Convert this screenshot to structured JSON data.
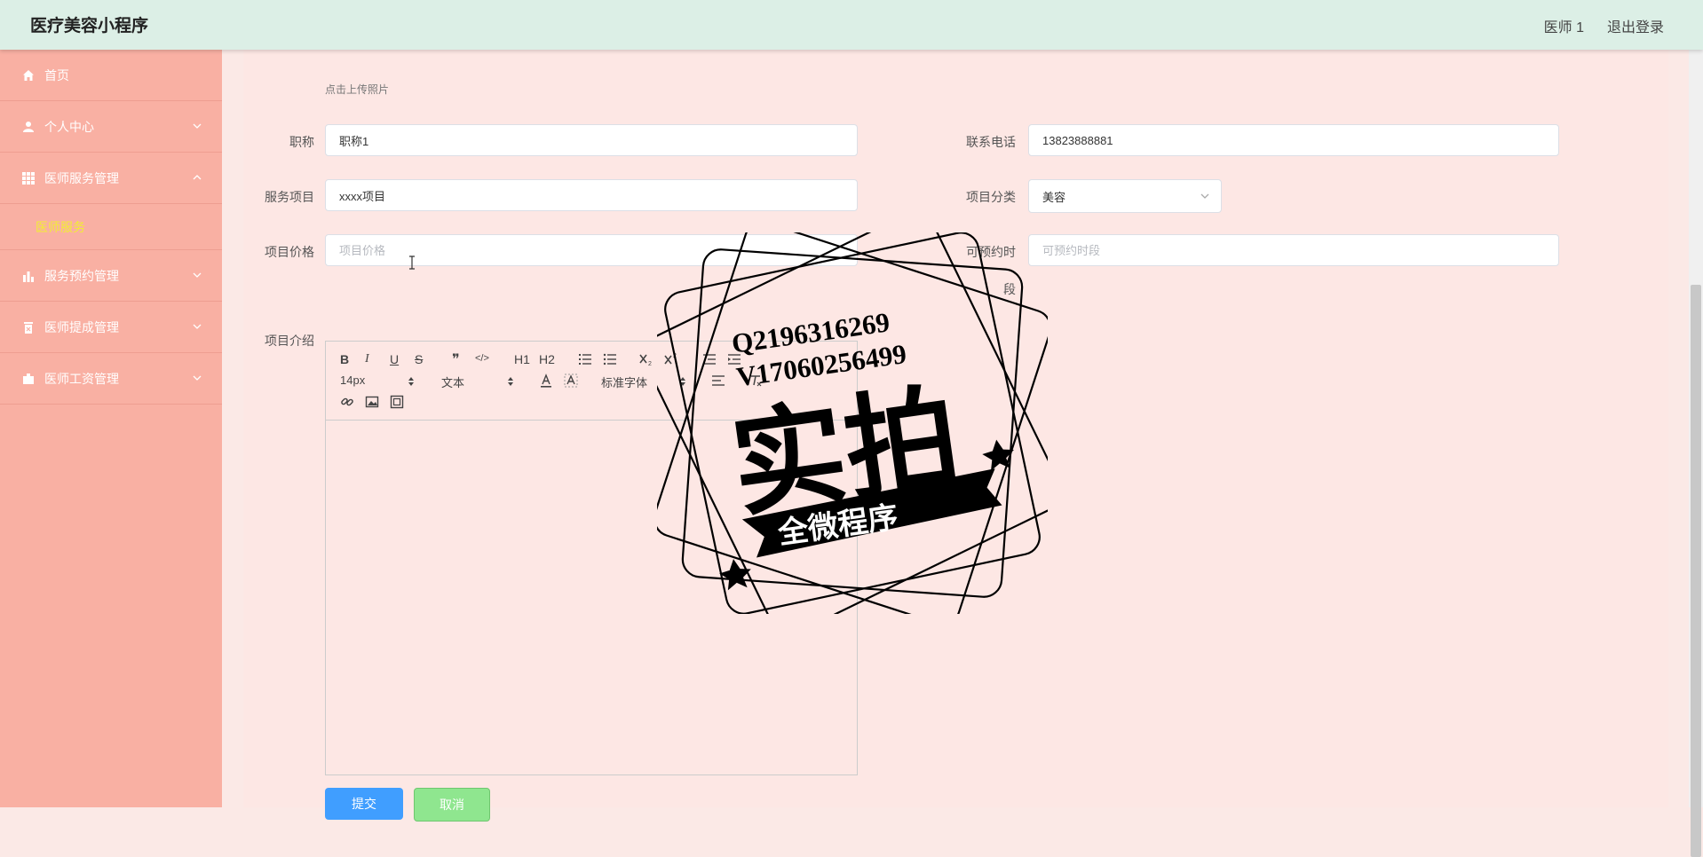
{
  "header": {
    "title": "医疗美容小程序",
    "user": "医师 1",
    "logout": "退出登录"
  },
  "sidebar": {
    "items": [
      {
        "label": "首页",
        "icon": "home-icon"
      },
      {
        "label": "个人中心",
        "icon": "user-icon"
      },
      {
        "label": "医师服务管理",
        "icon": "grid-icon"
      },
      {
        "label": "服务预约管理",
        "icon": "bar-chart-icon"
      },
      {
        "label": "医师提成管理",
        "icon": "trash-icon"
      },
      {
        "label": "医师工资管理",
        "icon": "wallet-icon"
      }
    ],
    "submenu": "医师服务"
  },
  "form": {
    "upload_hint": "点击上传照片",
    "title_label": "职称",
    "title_value": "职称1",
    "phone_label": "联系电话",
    "phone_value": "13823888881",
    "service_label": "服务项目",
    "service_value": "xxxx项目",
    "category_label": "项目分类",
    "category_value": "美容",
    "price_label": "项目价格",
    "price_placeholder": "项目价格",
    "time_label": "可预约时",
    "time_label2": "段",
    "time_placeholder": "可预约时段",
    "intro_label": "项目介绍"
  },
  "editor": {
    "font_size": "14px",
    "text_style": "文本",
    "font_family": "标准字体",
    "buttons": [
      "B",
      "I",
      "U",
      "S",
      "❞",
      "</>",
      "H1",
      "H2"
    ]
  },
  "actions": {
    "submit": "提交",
    "cancel": "取消"
  },
  "watermark": {
    "qq": "Q2196316269",
    "v": "V17060256499",
    "big": "实拍",
    "banner": "全微程序"
  },
  "colors": {
    "sidebar": "#f9b0a3",
    "header": "#dcefe6",
    "submenu_text": "#f2ee33",
    "submit": "#409eff",
    "cancel": "#8fe68f"
  }
}
